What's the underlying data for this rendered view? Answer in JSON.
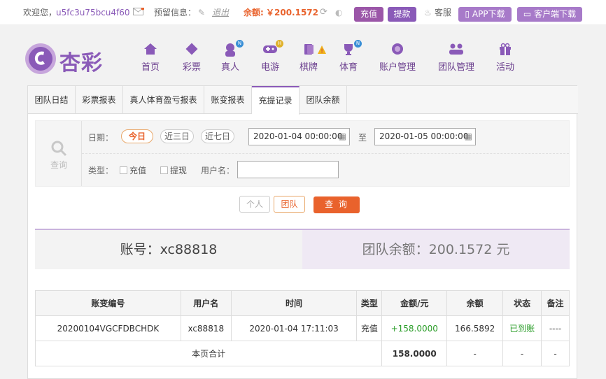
{
  "topbar": {
    "welcome": "欢迎您，",
    "username": "u5fc3u75bcu4f60",
    "warning_label": "预留信息：",
    "logout": "退出",
    "balance_label": "余额:",
    "balance_value": "￥200.1572",
    "deposit": "充值",
    "withdraw": "提款",
    "service": "客服",
    "app_download": "APP下载",
    "client_download": "客户端下载"
  },
  "brand": {
    "name": "杏彩"
  },
  "nav": [
    {
      "label": "首页",
      "icon": "home-icon"
    },
    {
      "label": "彩票",
      "icon": "lottery-icon"
    },
    {
      "label": "真人",
      "icon": "live-icon",
      "badge": "N"
    },
    {
      "label": "电游",
      "icon": "gamepad-icon",
      "badge": "H"
    },
    {
      "label": "棋牌",
      "icon": "cards-icon"
    },
    {
      "label": "体育",
      "icon": "trophy-icon",
      "badge": "N"
    },
    {
      "label": "账户管理",
      "icon": "account-icon"
    },
    {
      "label": "团队管理",
      "icon": "team-icon"
    },
    {
      "label": "活动",
      "icon": "gift-icon"
    }
  ],
  "tabs": [
    "团队日结",
    "彩票报表",
    "真人体育盈亏报表",
    "账变报表",
    "充提记录",
    "团队余额"
  ],
  "filter": {
    "query_label": "查询",
    "date_label": "日期：",
    "today": "今日",
    "last3": "近三日",
    "last7": "近七日",
    "start": "2020-01-04 00:00:00",
    "to": "至",
    "end": "2020-01-05 00:00:00",
    "type_label": "类型：",
    "deposit": "充值",
    "withdraw": "提现",
    "user_label": "用户名：",
    "user_value": ""
  },
  "buttons": {
    "personal": "个人",
    "team": "团队",
    "search": "查 询"
  },
  "account": {
    "account": "账号：xc88818",
    "team_balance": "团队余额：200.1572 元"
  },
  "table": {
    "headers": [
      "账变编号",
      "用户名",
      "时间",
      "类型",
      "金额/元",
      "余额",
      "状态",
      "备注"
    ],
    "rows": [
      [
        "20200104VGCFDBCHDK",
        "xc88818",
        "2020-01-04 17:11:03",
        "充值",
        "+158.0000",
        "166.5892",
        "已到账",
        "----"
      ]
    ],
    "summary": {
      "label": "本页合计",
      "amount": "158.0000",
      "balance": "-",
      "status": "-",
      "remark": "-"
    }
  },
  "colors": {
    "accent": "#8a5ab8",
    "orange": "#e9622c",
    "green": "#2a9d28"
  }
}
